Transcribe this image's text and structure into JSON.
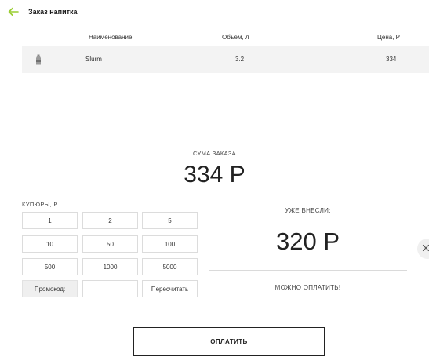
{
  "header": {
    "title": "Заказ напитка",
    "accent": "#9acd32"
  },
  "order_table": {
    "columns": {
      "name": "Наименование",
      "volume": "Объём, л",
      "price": "Цена, Р"
    },
    "rows": [
      {
        "icon": "bottle-icon",
        "name": "Slurm",
        "volume": "3.2",
        "price": "334"
      }
    ]
  },
  "summary": {
    "label": "СУМА ЗАКАЗА",
    "value": "334 Р"
  },
  "bills": {
    "label": "КУПЮРЫ, Р",
    "row1": [
      "1",
      "2",
      "5"
    ],
    "row2": [
      "10",
      "50",
      "100"
    ],
    "row3": [
      "500",
      "1000",
      "5000"
    ],
    "promo_label": "Промокод:",
    "promo_value": "",
    "recalc_label": "Пересчитать"
  },
  "payment": {
    "paid_label": "УЖЕ ВНЕСЛИ:",
    "paid_value": "320 Р",
    "status": "МОЖНО ОПЛАТИТЬ!",
    "pay_button": "ОПЛАТИТЬ"
  }
}
